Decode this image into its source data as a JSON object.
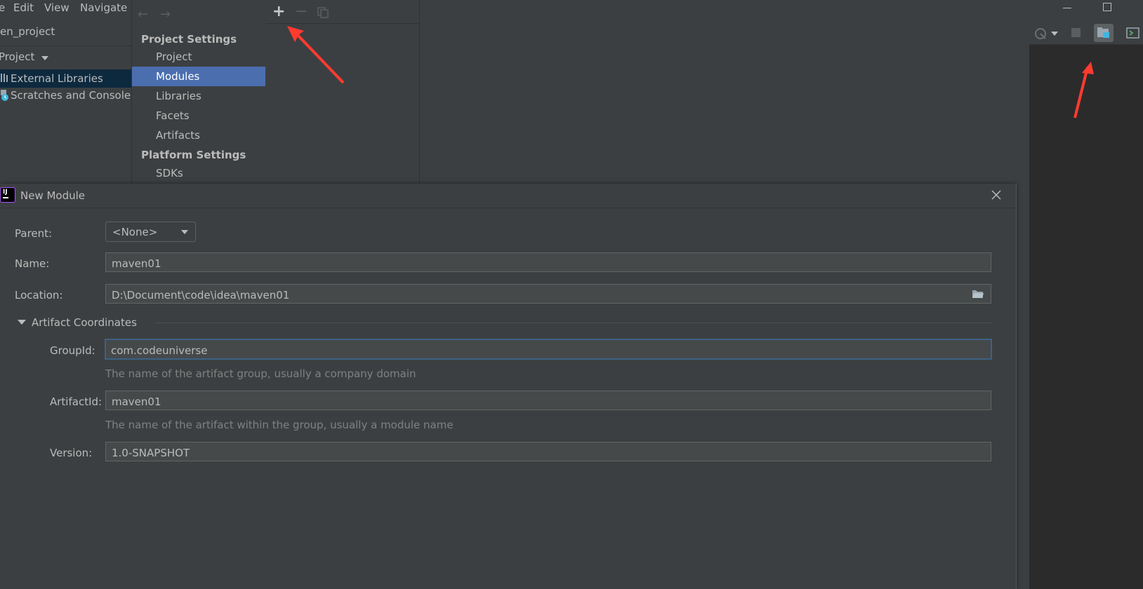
{
  "menubar": {
    "items": [
      "e",
      "Edit",
      "View",
      "Navigate"
    ]
  },
  "project": {
    "title": "en_project",
    "tool_label": "Project",
    "tree": [
      {
        "label": "External Libraries",
        "icon": "library-icon"
      },
      {
        "label": "Scratches and Consoles",
        "icon": "scratch-icon"
      }
    ]
  },
  "project_structure": {
    "project_settings_header": "Project Settings",
    "project_settings_items": [
      "Project",
      "Modules",
      "Libraries",
      "Facets",
      "Artifacts"
    ],
    "selected_item": "Modules",
    "platform_settings_header": "Platform Settings",
    "platform_settings_items": [
      "SDKs"
    ],
    "toolbar": {
      "add": "+",
      "remove": "−"
    }
  },
  "dialog": {
    "title": "New Module",
    "parent_label": "Parent:",
    "parent_value": "<None>",
    "name_label": "Name:",
    "name_value": "maven01",
    "location_label": "Location:",
    "location_value": "D:\\Document\\code\\idea\\maven01",
    "artifact_section": "Artifact Coordinates",
    "groupid_label": "GroupId:",
    "groupid_value": "com.codeuniverse",
    "groupid_hint": "The name of the artifact group, usually a company domain",
    "artifactid_label": "ArtifactId:",
    "artifactid_value": "maven01",
    "artifactid_hint": "The name of the artifact within the group, usually a module name",
    "version_label": "Version:",
    "version_value": "1.0-SNAPSHOT"
  },
  "colors": {
    "background": "#3c3f41",
    "selection": "#4b6eaf",
    "field_bg": "#45494a",
    "focus_border": "#3d6185",
    "annotation_arrow": "#ff3b30"
  }
}
